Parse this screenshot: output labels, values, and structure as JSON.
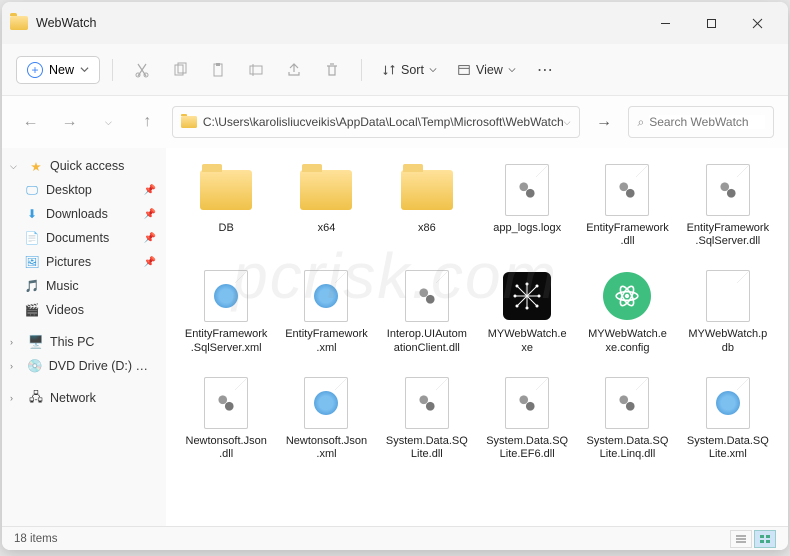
{
  "window": {
    "title": "WebWatch"
  },
  "toolbar": {
    "new": "New",
    "sort": "Sort",
    "view": "View"
  },
  "address": {
    "path": "C:\\Users\\karolisliucveikis\\AppData\\Local\\Temp\\Microsoft\\WebWatch"
  },
  "search": {
    "placeholder": "Search WebWatch"
  },
  "sidebar": {
    "quick": "Quick access",
    "items": [
      {
        "label": "Desktop",
        "pinned": true
      },
      {
        "label": "Downloads",
        "pinned": true
      },
      {
        "label": "Documents",
        "pinned": true
      },
      {
        "label": "Pictures",
        "pinned": true
      },
      {
        "label": "Music",
        "pinned": false
      },
      {
        "label": "Videos",
        "pinned": false
      }
    ],
    "thispc": "This PC",
    "dvd": "DVD Drive (D:) CCCC",
    "network": "Network"
  },
  "files": [
    {
      "name": "DB",
      "type": "folder"
    },
    {
      "name": "x64",
      "type": "folder"
    },
    {
      "name": "x86",
      "type": "folder"
    },
    {
      "name": "app_logs.logx",
      "type": "gear"
    },
    {
      "name": "EntityFramework.dll",
      "type": "gear"
    },
    {
      "name": "EntityFramework.SqlServer.dll",
      "type": "gear"
    },
    {
      "name": "EntityFramework.SqlServer.xml",
      "type": "xml"
    },
    {
      "name": "EntityFramework.xml",
      "type": "xml"
    },
    {
      "name": "Interop.UIAutomationClient.dll",
      "type": "gear"
    },
    {
      "name": "MYWebWatch.exe",
      "type": "exe-black"
    },
    {
      "name": "MYWebWatch.exe.config",
      "type": "exe-green"
    },
    {
      "name": "MYWebWatch.pdb",
      "type": "blank"
    },
    {
      "name": "Newtonsoft.Json.dll",
      "type": "gear"
    },
    {
      "name": "Newtonsoft.Json.xml",
      "type": "xml"
    },
    {
      "name": "System.Data.SQLite.dll",
      "type": "gear"
    },
    {
      "name": "System.Data.SQLite.EF6.dll",
      "type": "gear"
    },
    {
      "name": "System.Data.SQLite.Linq.dll",
      "type": "gear"
    },
    {
      "name": "System.Data.SQLite.xml",
      "type": "xml"
    }
  ],
  "status": {
    "count": "18 items"
  },
  "watermark": "pcrisk.com"
}
